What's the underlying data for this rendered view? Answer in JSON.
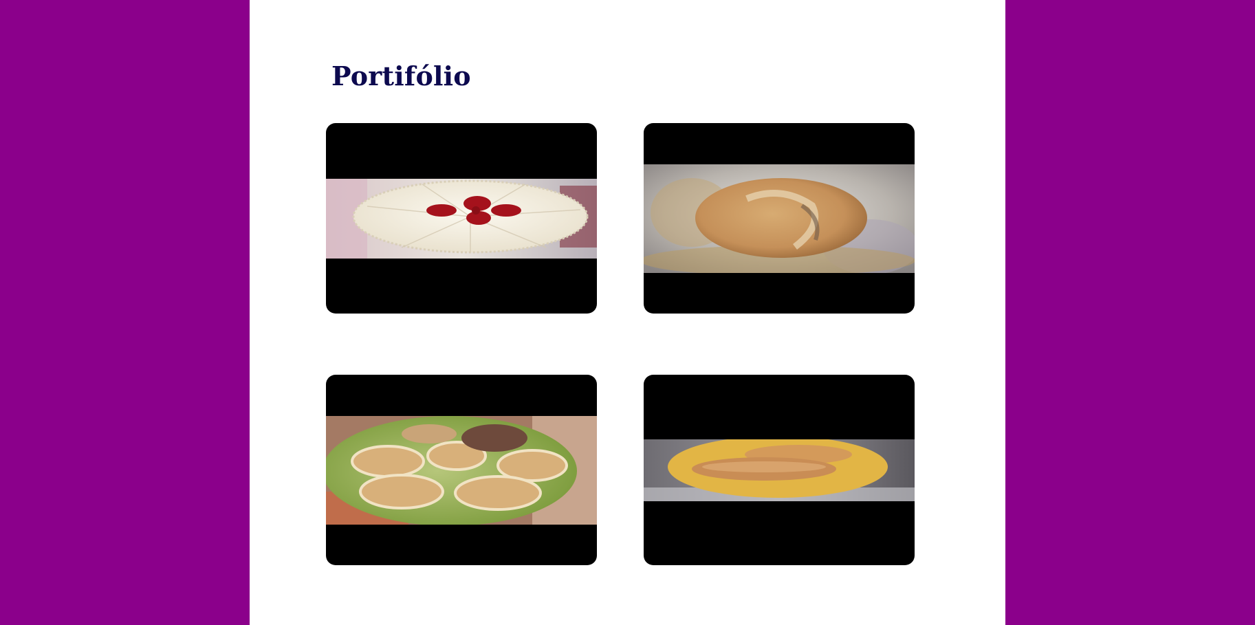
{
  "page": {
    "title": "Portifólio"
  },
  "colors": {
    "background": "#8b008b",
    "panel": "#ffffff",
    "title": "#0d0a4f",
    "card": "#000000"
  },
  "portfolio": {
    "items": [
      {
        "subject": "cake-with-red-flower"
      },
      {
        "subject": "bread-loaf-on-tray"
      },
      {
        "subject": "filled-buns-on-green-plate"
      },
      {
        "subject": "rolls-on-yellow-plate"
      }
    ]
  }
}
